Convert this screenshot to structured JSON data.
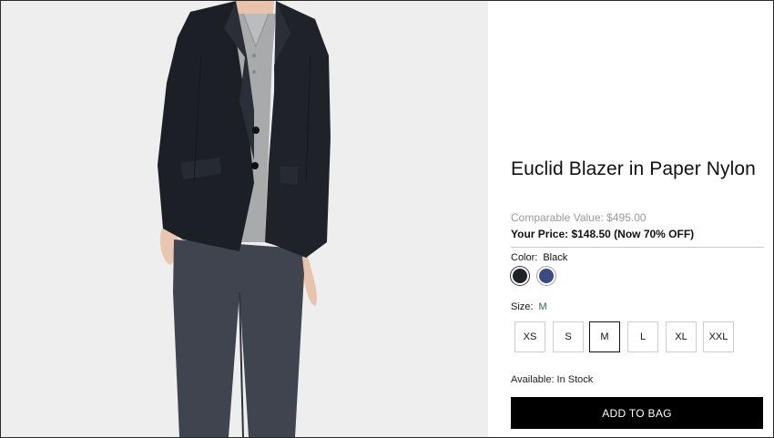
{
  "product": {
    "title": "Euclid Blazer in Paper Nylon",
    "comparable_value": "Comparable Value: $495.00",
    "your_price": "Your Price: $148.50 (Now 70% OFF)"
  },
  "color": {
    "label": "Color:",
    "selected": "Black",
    "swatches": [
      {
        "name": "Black",
        "hex": "#1e2229"
      },
      {
        "name": "Navy",
        "hex": "#3c4a80"
      }
    ]
  },
  "size": {
    "label": "Size:",
    "selected": "M",
    "options": [
      "XS",
      "S",
      "M",
      "L",
      "XL",
      "XXL"
    ]
  },
  "availability": "Available: In Stock",
  "add_to_bag": "ADD TO BAG",
  "colors": {
    "image_background": "#eeeeee",
    "button_background": "#000000"
  }
}
